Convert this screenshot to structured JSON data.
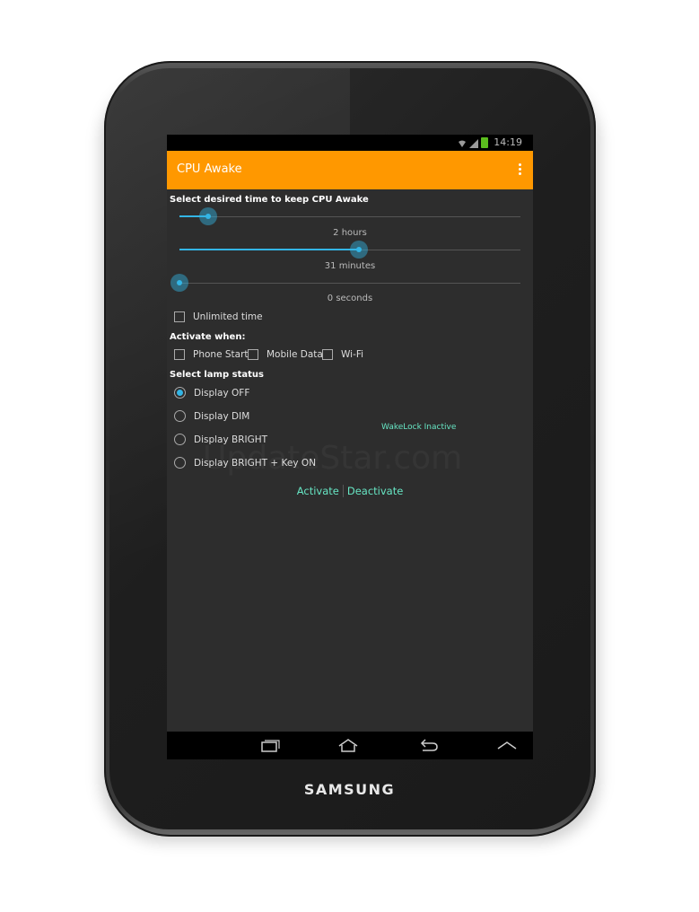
{
  "device": {
    "brand": "SAMSUNG"
  },
  "status_bar": {
    "time": "14:19",
    "icons": [
      "wifi-icon",
      "signal-icon",
      "battery-icon"
    ],
    "battery_color": "#5bbd1e"
  },
  "action_bar": {
    "title": "CPU Awake",
    "menu_icon": "overflow-menu-icon",
    "color": "#ff9800"
  },
  "timer": {
    "label": "Select desired time to keep CPU Awake",
    "hours": {
      "value": 2,
      "max": 24,
      "text": "2 hours"
    },
    "minutes": {
      "value": 31,
      "max": 59,
      "text": "31 minutes"
    },
    "seconds": {
      "value": 0,
      "max": 59,
      "text": "0 seconds"
    },
    "unlimited_label": "Unlimited time",
    "unlimited_checked": false,
    "accent": "#33b5e5"
  },
  "activate_when": {
    "label": "Activate when:",
    "options": [
      {
        "label": "Phone Start",
        "checked": false
      },
      {
        "label": "Mobile Data",
        "checked": false
      },
      {
        "label": "Wi-Fi",
        "checked": false
      }
    ]
  },
  "lamp": {
    "label": "Select lamp status",
    "options": [
      {
        "label": "Display OFF",
        "selected": true
      },
      {
        "label": "Display DIM",
        "selected": false
      },
      {
        "label": "Display BRIGHT",
        "selected": false
      },
      {
        "label": "Display BRIGHT + Key ON",
        "selected": false
      }
    ]
  },
  "wakelock_status": "WakeLock Inactive",
  "actions": {
    "activate": "Activate",
    "deactivate": "Deactivate"
  },
  "watermark": "UpdateStar.com",
  "nav_bar": {
    "icons": [
      "recent-apps-icon",
      "home-icon",
      "back-icon",
      "up-chevron-icon"
    ]
  }
}
